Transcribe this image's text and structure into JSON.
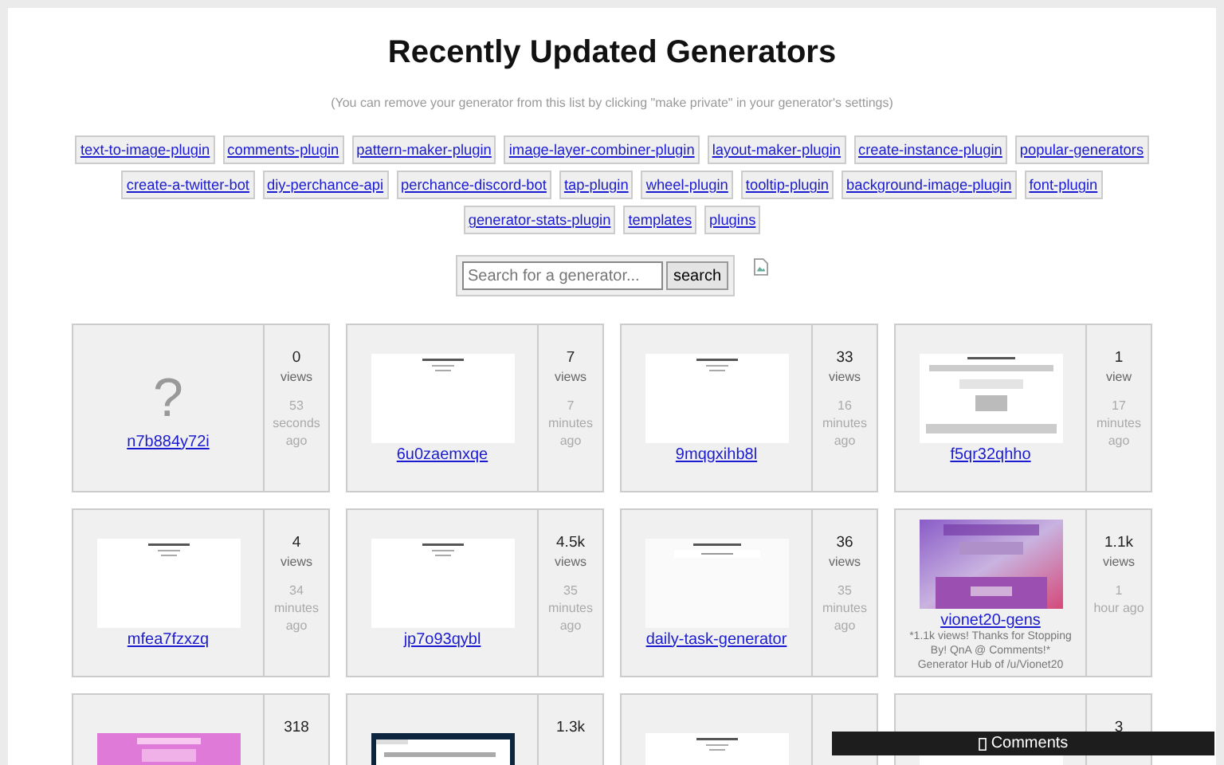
{
  "title": "Recently Updated Generators",
  "note": "(You can remove your generator from this list by clicking \"make private\" in your generator's settings)",
  "tags": [
    "text-to-image-plugin",
    "comments-plugin",
    "pattern-maker-plugin",
    "image-layer-combiner-plugin",
    "layout-maker-plugin",
    "create-instance-plugin",
    "popular-generators",
    "create-a-twitter-bot",
    "diy-perchance-api",
    "perchance-discord-bot",
    "tap-plugin",
    "wheel-plugin",
    "tooltip-plugin",
    "background-image-plugin",
    "font-plugin",
    "generator-stats-plugin",
    "templates",
    "plugins"
  ],
  "search": {
    "placeholder": "Search for a generator...",
    "button": "search"
  },
  "cards": [
    {
      "placeholder_glyph": "?",
      "name": "n7b884y72i",
      "views": "0",
      "views_label": "views",
      "age": [
        "53",
        "seconds",
        "ago"
      ]
    },
    {
      "kind": "picture",
      "name": "6u0zaemxqe",
      "views": "7",
      "views_label": "views",
      "age": [
        "7",
        "minutes",
        "ago"
      ]
    },
    {
      "kind": "picture",
      "name": "9mqgxihb8l",
      "views": "33",
      "views_label": "views",
      "age": [
        "16",
        "minutes",
        "ago"
      ]
    },
    {
      "kind": "picture",
      "name": "f5qr32qhho",
      "views": "1",
      "views_label": "view",
      "age": [
        "17",
        "minutes",
        "ago"
      ]
    },
    {
      "kind": "picture",
      "name": "mfea7fzxzq",
      "views": "4",
      "views_label": "views",
      "age": [
        "34",
        "minutes",
        "ago"
      ]
    },
    {
      "kind": "picture",
      "name": "jp7o93qybl",
      "views": "4.5k",
      "views_label": "views",
      "age": [
        "35",
        "minutes",
        "ago"
      ]
    },
    {
      "kind": "picture",
      "name": "daily-task-generator",
      "views": "36",
      "views_label": "views",
      "age": [
        "35",
        "minutes",
        "ago"
      ]
    },
    {
      "kind": "picture",
      "name": "vionet20-gens",
      "description": "*1.1k views! Thanks for Stopping By! QnA @ Comments!* Generator Hub of /u/Vionet20",
      "views": "1.1k",
      "views_label": "views",
      "age": [
        "1",
        "hour ago"
      ]
    },
    {
      "kind": "picture",
      "views": "318"
    },
    {
      "kind": "picture",
      "views": "1.3k"
    },
    {
      "kind": "picture"
    },
    {
      "kind": "picture",
      "views": "3"
    }
  ],
  "comments_bar": {
    "label": "Comments"
  }
}
